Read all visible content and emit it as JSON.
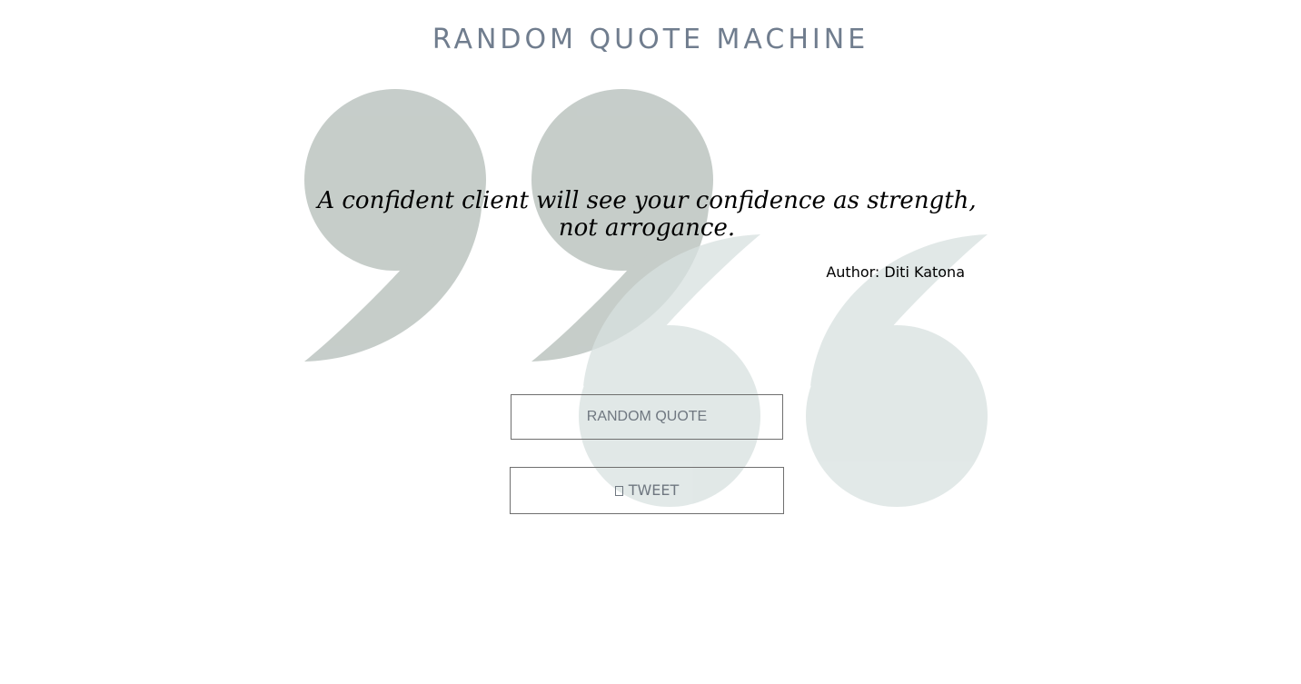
{
  "header": {
    "title": "RANDOM QUOTE MACHINE"
  },
  "quote": {
    "text": "A confident client will see your confidence as strength, not arrogance.",
    "author": "Author: Diti Katona"
  },
  "actions": {
    "random_label": "RANDOM QUOTE",
    "tweet_label": "TWEET",
    "tweet_icon": "twitter-icon"
  },
  "colors": {
    "title": "#707d8e",
    "quote_mark_dark": "#c5ccc9",
    "quote_mark_light": "#e3e9e8",
    "button_border": "#6f6f6f",
    "button_text": "#6f7780"
  }
}
